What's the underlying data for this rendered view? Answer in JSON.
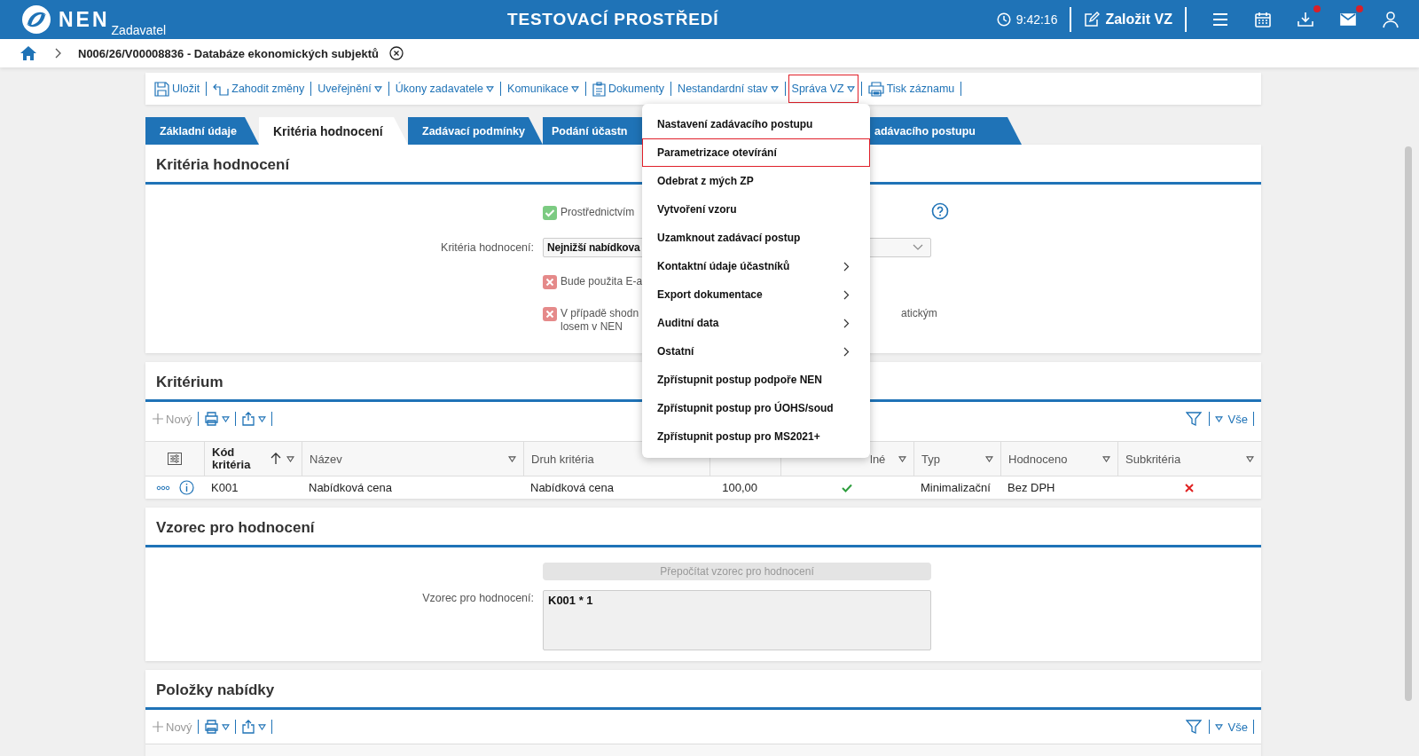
{
  "header": {
    "logo": "NEN",
    "role": "Zadavatel",
    "environment": "TESTOVACÍ PROSTŘEDÍ",
    "time": "9:42:16",
    "create_button": "Založit VZ",
    "icons": [
      {
        "kind": "menu",
        "badge": false
      },
      {
        "kind": "calendar",
        "badge": false
      },
      {
        "kind": "download",
        "badge": true
      },
      {
        "kind": "mail",
        "badge": true
      },
      {
        "kind": "user",
        "badge": false
      }
    ]
  },
  "breadcrumb": {
    "title": "N006/26/V00008836 - Databáze ekonomických subjektů"
  },
  "toolbar": [
    {
      "label": "Uložit",
      "kind": "save",
      "dropdown": false,
      "highlighted": false
    },
    {
      "label": "Zahodit změny",
      "kind": "discard",
      "dropdown": false,
      "highlighted": false
    },
    {
      "label": "Uveřejnění",
      "dropdown": true,
      "highlighted": false
    },
    {
      "label": "Úkony zadavatele",
      "dropdown": true,
      "highlighted": false
    },
    {
      "label": "Komunikace",
      "dropdown": true,
      "highlighted": false
    },
    {
      "label": "Dokumenty",
      "kind": "document",
      "dropdown": false,
      "highlighted": false
    },
    {
      "label": "Nestandardní stav",
      "dropdown": true,
      "highlighted": false
    },
    {
      "label": "Správa VZ",
      "dropdown": true,
      "highlighted": true
    },
    {
      "label": "Tisk záznamu",
      "kind": "print",
      "dropdown": false,
      "highlighted": false
    }
  ],
  "tabs": [
    {
      "label": "Základní údaje",
      "selected": false
    },
    {
      "label": "Kritéria hodnocení",
      "selected": true
    },
    {
      "label": "Zadávací podmínky",
      "selected": false
    },
    {
      "label": "Podání účastn",
      "selected": false
    },
    {
      "label": "adávacího postupu",
      "selected": false
    }
  ],
  "criteria_section": {
    "title": "Kritéria hodnocení",
    "rows": [
      {
        "kind": "flag",
        "positive": true,
        "lines": [
          "Prostřednictvím"
        ],
        "help": true
      },
      {
        "kind": "select",
        "label": "Kritéria hodnocení:",
        "value": "Nejnižší nabídkova"
      },
      {
        "kind": "flag",
        "positive": false,
        "lines": [
          "Bude použita E-a"
        ]
      },
      {
        "kind": "flag",
        "positive": false,
        "lines": [
          "V případě shodn",
          "losem v NEN"
        ],
        "tail": "atickým"
      }
    ]
  },
  "criterion_section": {
    "title": "Kritérium",
    "new_button": "Nový",
    "filter_all": "Vše",
    "columns": [
      {
        "label": "Kód kritéria",
        "sorted": true,
        "filter": true
      },
      {
        "label": "Název",
        "sorted": false,
        "filter": true
      },
      {
        "label": "Druh kritéria",
        "sorted": false,
        "filter": false
      },
      {
        "sorted": false,
        "filter": false
      },
      {
        "label": "lné",
        "sorted": false,
        "filter": true
      },
      {
        "label": "Typ",
        "sorted": false,
        "filter": true
      },
      {
        "label": "Hodnoceno",
        "sorted": false,
        "filter": true
      },
      {
        "label": "Subkritéria",
        "sorted": false,
        "filter": true
      }
    ],
    "rows": [
      {
        "code": "K001",
        "name": "Nabídková cena",
        "criterion_kind": "Nabídková cena",
        "column_4": "100,00",
        "column_5": true,
        "type": "Minimalizační",
        "evaluated": "Bez DPH",
        "subcriteria": false
      }
    ]
  },
  "formula_section": {
    "title": "Vzorec pro hodnocení",
    "recalc_button": {
      "label": "Přepočítat vzorec pro hodnocení",
      "disabled": true
    },
    "label": "Vzorec pro hodnocení:",
    "value": "K001 * 1"
  },
  "offer_items_section": {
    "title": "Položky nabídky",
    "new_button": "Nový",
    "filter_all": "Vše"
  },
  "dropdown_menu": [
    {
      "label": "Nastavení zadávacího postupu",
      "submenu": false,
      "highlighted": false
    },
    {
      "label": "Parametrizace otevírání",
      "submenu": false,
      "highlighted": true
    },
    {
      "label": "Odebrat z mých ZP",
      "submenu": false,
      "highlighted": false
    },
    {
      "label": "Vytvoření vzoru",
      "submenu": false,
      "highlighted": false
    },
    {
      "label": "Uzamknout zadávací postup",
      "submenu": false,
      "highlighted": false
    },
    {
      "label": "Kontaktní údaje účastníků",
      "submenu": true,
      "highlighted": false
    },
    {
      "label": "Export dokumentace",
      "submenu": true,
      "highlighted": false
    },
    {
      "label": "Auditní data",
      "submenu": true,
      "highlighted": false
    },
    {
      "label": "Ostatní",
      "submenu": true,
      "highlighted": false
    },
    {
      "label": "Zpřístupnit postup podpoře NEN",
      "submenu": false,
      "highlighted": false
    },
    {
      "label": "Zpřístupnit postup pro ÚOHS/soud",
      "submenu": false,
      "highlighted": false
    },
    {
      "label": "Zpřístupnit postup pro MS2021+",
      "submenu": false,
      "highlighted": false
    }
  ]
}
